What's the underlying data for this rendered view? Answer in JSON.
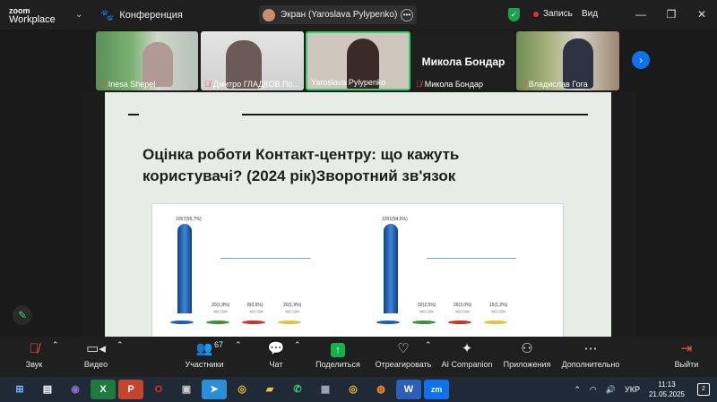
{
  "app": {
    "logo_line1": "zoom",
    "logo_line2": "Workplace",
    "meeting_name": "Конференция"
  },
  "screen_share": {
    "label": "Экран (Yaroslava Pylypenko)"
  },
  "status": {
    "recording_label": "Запись",
    "view_label": "Вид"
  },
  "participants_strip": [
    {
      "name": "Inesa Shepel",
      "muted": true
    },
    {
      "name": "Дмитро ГЛАДКОВ По...",
      "muted": true
    },
    {
      "name": "Yaroslava Pylypenko",
      "muted": false,
      "active_speaker": true
    },
    {
      "name": "Микола Бондар",
      "muted": true,
      "display_name_large": "Микола Бондар"
    },
    {
      "name": "Владислав Гога",
      "muted": true
    }
  ],
  "slide": {
    "title": "Оцінка роботи Контакт-центру: що кажуть користувачі? (2024 рік)Зворотний зв'язок"
  },
  "chart_data": [
    {
      "type": "bar",
      "categories": [
        "",
        "",
        "",
        ""
      ],
      "values": [
        1057,
        20,
        8,
        20
      ],
      "value_labels": [
        "1057(95,7%)",
        "20(1,8%)",
        "8(0,6%)",
        "20(1,9%)"
      ],
      "bar_colors": [
        "#1f5fb0",
        "#d0d0d0",
        "#d0d0d0",
        "#d0d0d0"
      ],
      "legend_colors": [
        "#1f5fb0",
        "#3f8f3f",
        "#c0392b",
        "#e0c341"
      ]
    },
    {
      "type": "bar",
      "categories": [
        "",
        "",
        "",
        ""
      ],
      "values": [
        1201,
        32,
        26,
        15
      ],
      "value_labels": [
        "1201(94,5%)",
        "32(2,5%)",
        "26(2,0%)",
        "15(1,2%)"
      ],
      "bar_colors": [
        "#1f5fb0",
        "#d0d0d0",
        "#d0d0d0",
        "#d0d0d0"
      ],
      "legend_colors": [
        "#1f5fb0",
        "#3f8f3f",
        "#c0392b",
        "#e0c341"
      ]
    }
  ],
  "toolbar": {
    "audio": "Звук",
    "video": "Видео",
    "participants": "Участники",
    "participants_count": "67",
    "chat": "Чат",
    "share": "Поделиться",
    "react": "Отреагировать",
    "ai": "AI Companion",
    "apps": "Приложения",
    "more": "Дополнительно",
    "leave": "Выйти"
  },
  "taskbar": {
    "language": "УКР",
    "time": "11:13",
    "date": "21.05.2025",
    "notifications": "2"
  }
}
